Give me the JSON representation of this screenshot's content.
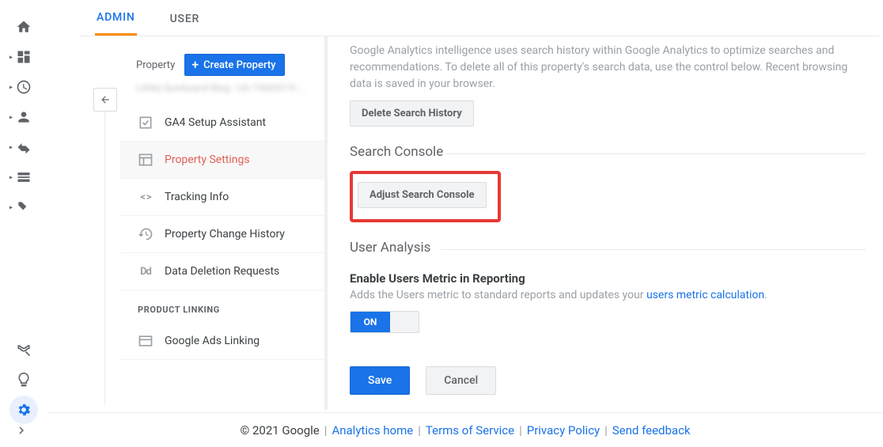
{
  "tabs": {
    "admin": "ADMIN",
    "user": "USER"
  },
  "rail": {
    "icons": [
      "home",
      "dashboard",
      "clock",
      "person",
      "flow",
      "attribution",
      "window",
      "flag",
      "discover",
      "insights",
      "settings",
      "collapse"
    ]
  },
  "admin": {
    "prop_label": "Property",
    "create_label": "Create Property",
    "prop_name": "Littley Quicksand Blog - UA-73660219-...",
    "items": {
      "ga4": "GA4 Setup Assistant",
      "settings": "Property Settings",
      "tracking": "Tracking Info",
      "history": "Property Change History",
      "deletion": "Data Deletion Requests"
    },
    "section_linking": "PRODUCT LINKING",
    "ads_linking": "Google Ads Linking"
  },
  "main": {
    "intro": "Google Analytics intelligence uses search history within Google Analytics to optimize searches and recommendations. To delete all of this property's search data, use the control below. Recent browsing data is saved in your browser.",
    "delete_search": "Delete Search History",
    "search_console_title": "Search Console",
    "adjust_sc": "Adjust Search Console",
    "user_analysis_title": "User Analysis",
    "enable_users_head": "Enable Users Metric in Reporting",
    "enable_users_desc": "Adds the Users metric to standard reports and updates your ",
    "enable_users_link": "users metric calculation",
    "toggle_on": "ON",
    "save": "Save",
    "cancel": "Cancel"
  },
  "footer": {
    "copyright": "© 2021 Google",
    "home": "Analytics home",
    "tos": "Terms of Service",
    "privacy": "Privacy Policy",
    "feedback": "Send feedback"
  }
}
